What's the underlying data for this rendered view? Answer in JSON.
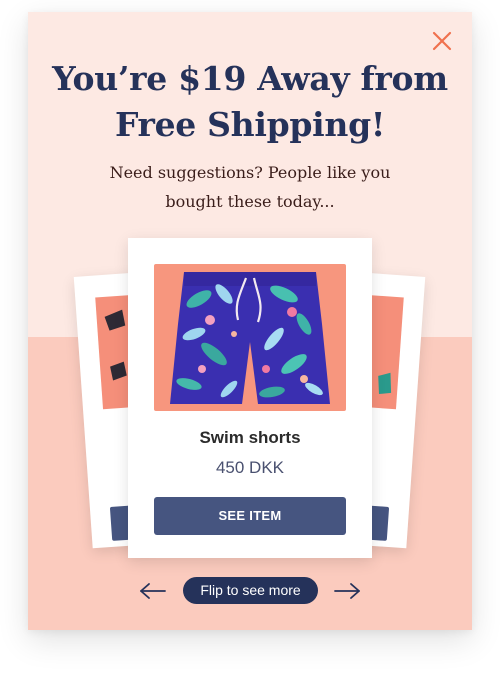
{
  "popup": {
    "headline_line1": "You’re $19 Away from",
    "headline_line2": "Free Shipping!",
    "subline_line1": "Need suggestions? People like you",
    "subline_line2": "bought these today...",
    "close_icon": "close-icon",
    "accent_color": "#f0714e"
  },
  "product": {
    "name": "Swim shorts",
    "price": "450 DKK",
    "button_label": "SEE ITEM",
    "image": "floral-swim-shorts-image"
  },
  "carousel": {
    "flip_label": "Flip to see more",
    "prev_icon": "arrow-left-icon",
    "next_icon": "arrow-right-icon"
  },
  "colors": {
    "navy": "#25325a",
    "button": "#465580",
    "bg_top": "#fde9e3",
    "bg_bottom": "#fbcbbe",
    "image_bg": "#f7967e"
  }
}
